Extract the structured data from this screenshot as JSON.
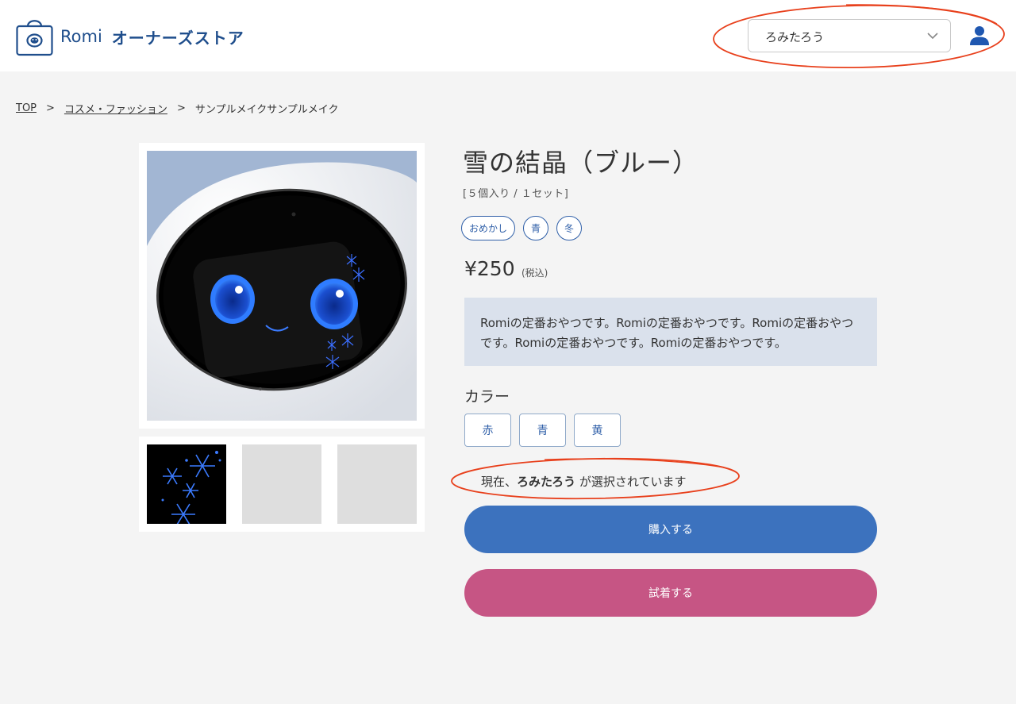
{
  "header": {
    "logo": {
      "brand": "Romi",
      "store": "オーナーズストア"
    },
    "owner_select": {
      "value": "ろみたろう"
    },
    "icons": {
      "bag": "shopping-bag-icon",
      "chevron": "chevron-down-icon",
      "user": "user-icon"
    }
  },
  "breadcrumb": {
    "items": [
      {
        "label": "TOP"
      },
      {
        "label": "コスメ・ファッション"
      },
      {
        "label": "サンプルメイクサンプルメイク"
      }
    ],
    "separator": ">"
  },
  "product": {
    "title": "雪の結晶（ブルー）",
    "subtitle": "[５個入り / １セット]",
    "tags": [
      "おめかし",
      "青",
      "冬"
    ],
    "price": "¥250",
    "tax_note": "(税込)",
    "description": "Romiの定番おやつです。Romiの定番おやつです。Romiの定番おやつです。Romiの定番おやつです。Romiの定番おやつです。",
    "color_label": "カラー",
    "colors": [
      "赤",
      "青",
      "黄"
    ],
    "selected": {
      "prefix": "現在、",
      "name": "ろみたろう",
      "suffix": " が選択されています"
    },
    "buy_button": "購入する",
    "try_button": "試着する"
  },
  "theme": {
    "brand": "#1f4e8c",
    "buy": "#3c72be",
    "try": "#c65584",
    "annotation": "#e8401c"
  }
}
